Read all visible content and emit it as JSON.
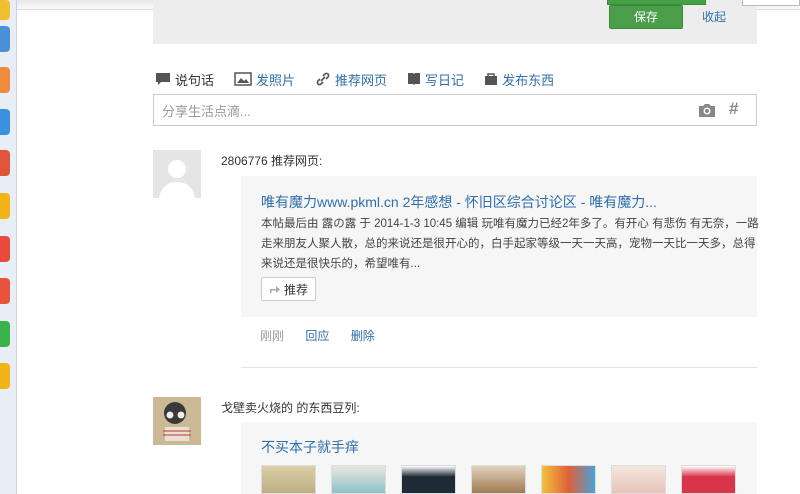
{
  "editor": {
    "save_label": "保存",
    "collapse_label": "收起"
  },
  "tabs": [
    {
      "label": "说句话",
      "icon": "speech-bubble-icon",
      "active": true
    },
    {
      "label": "发照片",
      "icon": "picture-icon"
    },
    {
      "label": "推荐网页",
      "icon": "link-icon"
    },
    {
      "label": "写日记",
      "icon": "book-icon"
    },
    {
      "label": "发布东西",
      "icon": "bag-icon"
    }
  ],
  "share": {
    "placeholder": "分享生活点滴...",
    "camera_icon": "camera-icon",
    "topic_symbol": "#"
  },
  "feed": [
    {
      "user_line": "2806776 推荐网页:",
      "card_title": "唯有魔力www.pkml.cn 2年感想 - 怀旧区综合讨论区 - 唯有魔力...",
      "card_text": "本帖最后由 露の露 于 2014-1-3 10:45 编辑 玩唯有魔力已经2年多了。有开心 有悲伤 有无奈，一路走来朋友人聚人散，总的来说还是很开心的，白手起家等级一天一天高，宠物一天比一天多，总得来说还是很快乐的，希望唯有...",
      "recommend_label": "推荐",
      "time": "刚刚",
      "reply": "回应",
      "delete": "删除"
    },
    {
      "user_line": "戈壁卖火烧的 的东西豆列:",
      "card_title": "不买本子就手痒"
    }
  ],
  "colors": {
    "link": "#2f6fab",
    "green": "#4a9e4a"
  }
}
